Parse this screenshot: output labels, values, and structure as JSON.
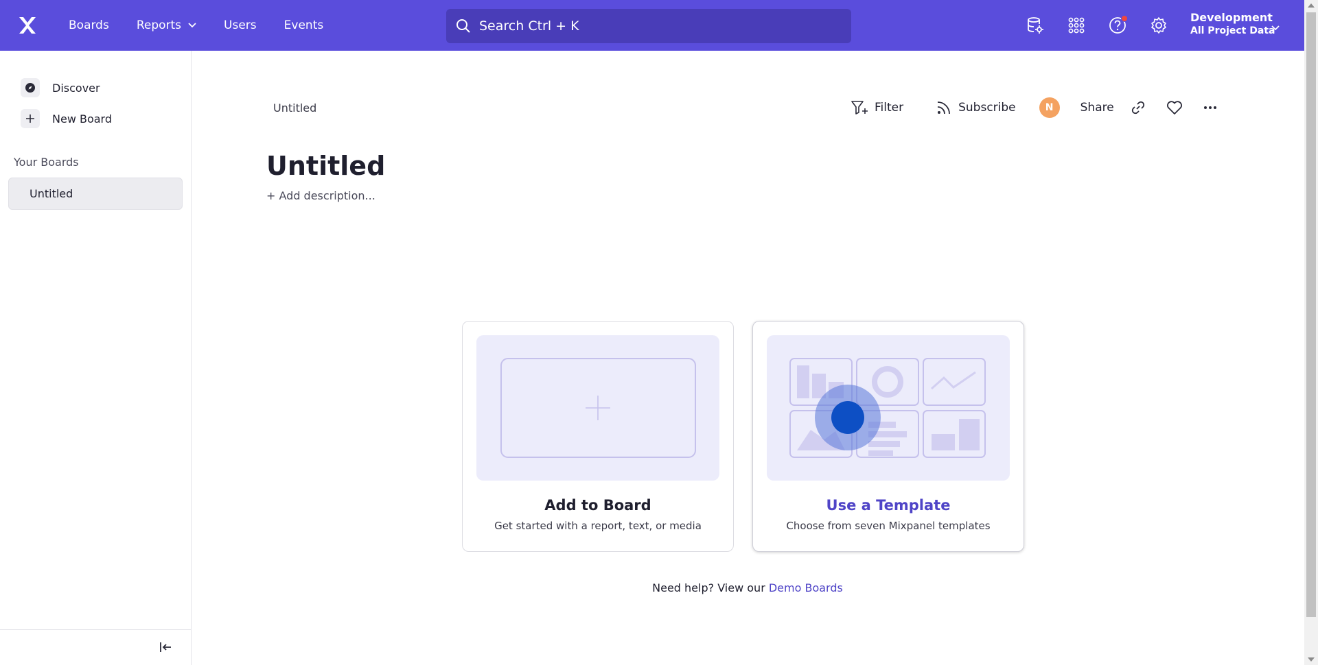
{
  "header": {
    "nav": [
      {
        "label": "Boards"
      },
      {
        "label": "Reports",
        "has_dropdown": true
      },
      {
        "label": "Users"
      },
      {
        "label": "Events"
      }
    ],
    "search": {
      "label": "Search  Ctrl + K"
    },
    "icons": [
      "database-settings-icon",
      "apps-grid-icon",
      "help-icon",
      "settings-icon"
    ],
    "project": {
      "name": "Development",
      "data_view": "All Project Data"
    }
  },
  "sidebar": {
    "links": [
      {
        "label": "Discover",
        "icon": "compass-icon"
      },
      {
        "label": "New Board",
        "icon": "plus-icon"
      }
    ],
    "section_title": "Your Boards",
    "boards": [
      {
        "label": "Untitled"
      }
    ]
  },
  "main": {
    "breadcrumb": "Untitled",
    "actions": {
      "filter": "Filter",
      "subscribe": "Subscribe",
      "avatar_initial": "N",
      "share": "Share"
    },
    "title": "Untitled",
    "add_description": "+ Add description...",
    "cards": [
      {
        "title": "Add to Board",
        "subtitle": "Get started with a report, text, or media"
      },
      {
        "title": "Use a Template",
        "subtitle": "Choose from seven Mixpanel templates"
      }
    ],
    "help": {
      "prefix": "Need help? View our ",
      "link": "Demo Boards"
    }
  },
  "colors": {
    "brand": "#5a4ddc",
    "accent_text": "#4f44c7",
    "avatar": "#f4a261",
    "notification": "#f0463d"
  }
}
